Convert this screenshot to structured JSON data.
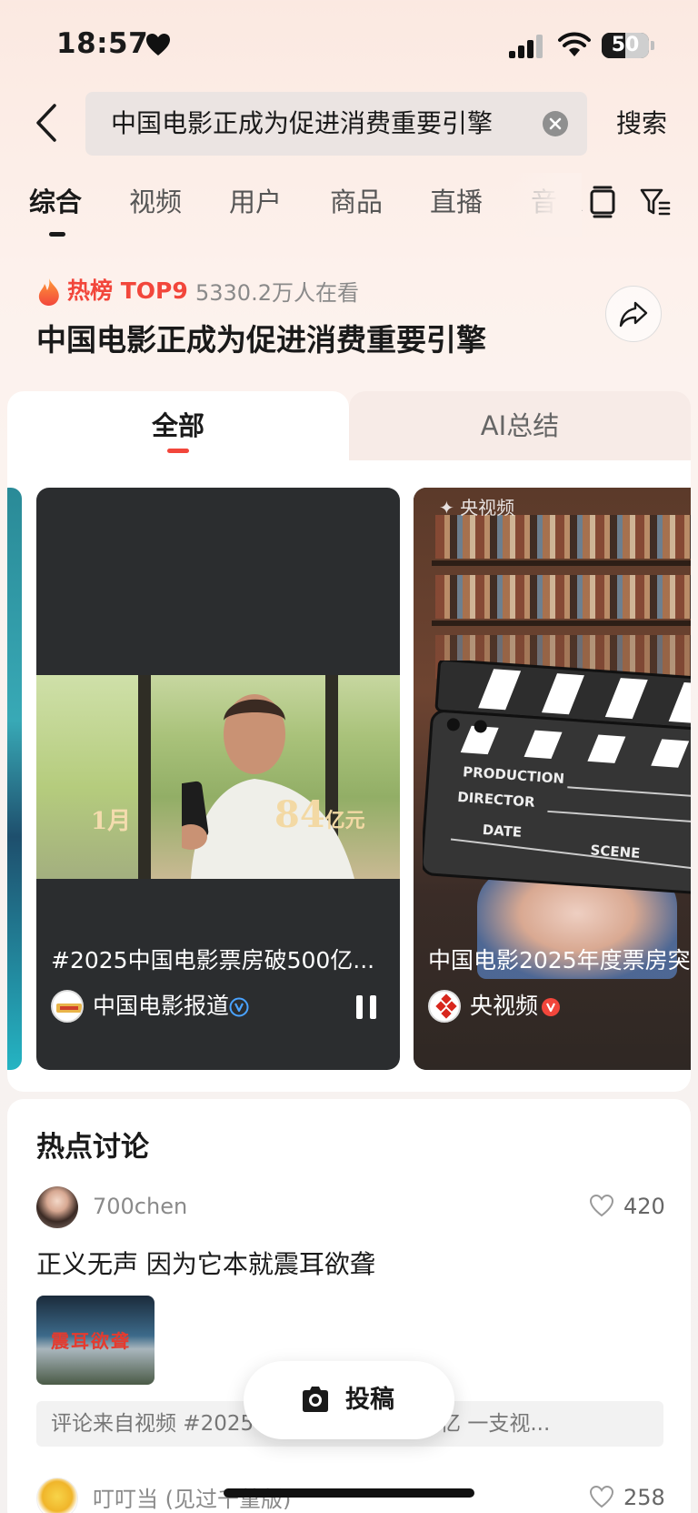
{
  "status_bar": {
    "time": "18:57",
    "battery": "50",
    "battery_level": 0.5
  },
  "search": {
    "query": "中国电影正成为促进消费重要引擎",
    "submit_label": "搜索"
  },
  "tabs": [
    {
      "label": "综合",
      "active": true
    },
    {
      "label": "视频"
    },
    {
      "label": "用户"
    },
    {
      "label": "商品"
    },
    {
      "label": "直播"
    },
    {
      "label": "音乐"
    }
  ],
  "hot": {
    "rank": "热榜 TOP9",
    "views": "5330.2万人在看",
    "title": "中国电影正成为促进消费重要引擎"
  },
  "card_tabs": {
    "all": "全部",
    "ai": "AI总结"
  },
  "videos": [
    {
      "title": "#2025中国电影票房破500亿...",
      "author": "中国电影报道",
      "overlay_left": "1月",
      "overlay_right_num": "84",
      "overlay_right_unit": "亿元",
      "verify_color": "#4aa3ff"
    },
    {
      "title": "中国电影2025年度票房突",
      "author": "央视频",
      "watermark": "央视频",
      "clapper_lines": [
        "PRODUCTION",
        "DIRECTOR",
        "DATE",
        "SCENE"
      ],
      "verify_color": "#f2463b"
    }
  ],
  "discussion": {
    "title": "热点讨论",
    "posts": [
      {
        "user": "700chen",
        "likes": "420",
        "text": "正义无声 因为它本就震耳欲聋",
        "thumb_text": "震耳欲聋",
        "source": "评论来自视频 #2025中国电影票房破500亿 一支视..."
      },
      {
        "user": "叮叮当 (见过千堇版)",
        "likes": "258"
      }
    ]
  },
  "fab": {
    "label": "投稿"
  },
  "icons": {
    "back": "chevron-left-icon",
    "clear": "close-circle-icon",
    "filter": "filter-icon",
    "share": "share-arrow-icon",
    "fire": "fire-icon",
    "camera": "camera-icon",
    "like": "heart-outline-icon",
    "pause": "pause-icon"
  },
  "colors": {
    "accent": "#f2463b",
    "verify_blue": "#4aa3ff"
  }
}
